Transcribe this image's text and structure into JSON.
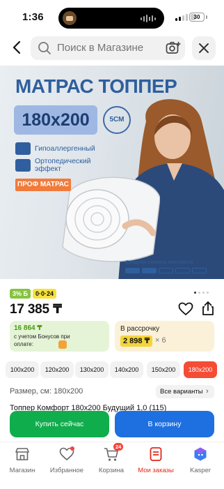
{
  "status_bar": {
    "time": "1:36",
    "battery": "30"
  },
  "search": {
    "placeholder": "Поиск в Магазине"
  },
  "banner": {
    "title": "МАТРАС ТОППЕР",
    "size": "180x200",
    "thickness": "5СМ",
    "features": [
      "Гипоаллергенный",
      "Ортопедический эффект"
    ],
    "brand_tag": "ПРОФ МАТРАС",
    "stiffness": "Средняя степень жесткости",
    "stiffness_level": 2,
    "stiffness_max": 5
  },
  "gallery": {
    "pages": 4,
    "active": 0
  },
  "badges": {
    "cashback": "3% Б",
    "rating": "0·0·24"
  },
  "price": "17 385 ₸",
  "bonus": {
    "price": "16 864 ₸",
    "text": "с учетом Бонусов при оплате:"
  },
  "installment": {
    "label": "В рассрочку",
    "amount": "2 898 ₸",
    "multiplier": "× 6"
  },
  "size_options": [
    "100x200",
    "120x200",
    "130x200",
    "140x200",
    "150x200",
    "180x200"
  ],
  "selected_size": "180x200",
  "size_row": {
    "label": "Размер, см: 180x200",
    "all_variants": "Все варианты"
  },
  "title_cut": "Топпер Комфорт 180x200 Будущий 1,0 (115)",
  "buttons": {
    "buy": "Купить сейчас",
    "cart": "В корзину"
  },
  "tabs": [
    {
      "label": "Магазин",
      "icon": "shop-icon"
    },
    {
      "label": "Избранное",
      "icon": "heart-icon"
    },
    {
      "label": "Корзина",
      "icon": "cart-icon",
      "badge": "24"
    },
    {
      "label": "Мои заказы",
      "icon": "orders-icon",
      "active": true
    },
    {
      "label": "Kasper",
      "icon": "kasper-icon"
    }
  ],
  "colors": {
    "accent_red": "#f54c36",
    "buy_green": "#10ad4c",
    "cart_blue": "#1e6fe0",
    "banner_blue": "#2e5f9e"
  }
}
